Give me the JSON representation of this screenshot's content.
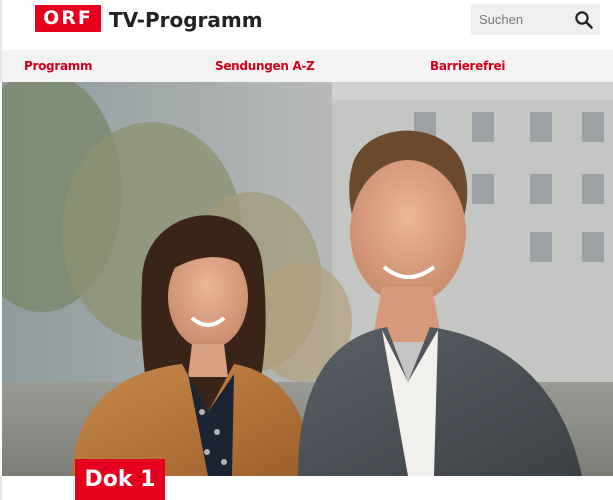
{
  "header": {
    "logo_text": "ORF",
    "title": "TV-Programm",
    "search": {
      "placeholder": "Suchen",
      "value": "",
      "icon": "search-icon"
    }
  },
  "nav": {
    "items": [
      {
        "label": "Programm"
      },
      {
        "label": "Sendungen A-Z"
      },
      {
        "label": "Barrierefrei"
      }
    ]
  },
  "hero": {
    "badge": "Dok 1"
  },
  "colors": {
    "brand_red": "#e5001e",
    "nav_link": "#d6001c",
    "nav_bg": "#f3f3f3",
    "search_bg": "#efefef"
  }
}
